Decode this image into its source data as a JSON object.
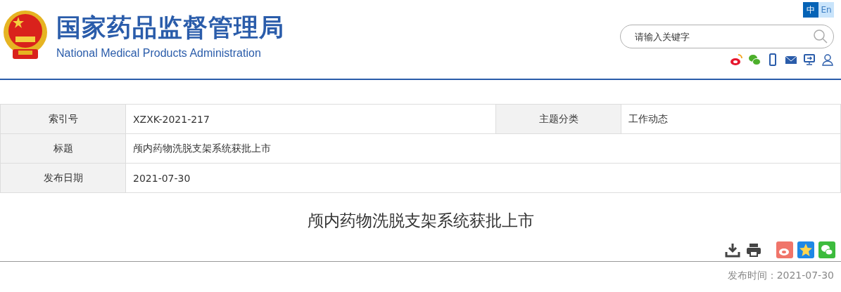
{
  "header": {
    "title": "国家药品监督管理局",
    "subtitle": "National Medical Products Administration",
    "languages": [
      {
        "label": "中",
        "selected": true
      },
      {
        "label": "En",
        "selected": false
      }
    ],
    "search": {
      "placeholder": "请输入关键字"
    }
  },
  "info_table": {
    "rows": [
      [
        {
          "label": "索引号",
          "value": "XZXK-2021-217"
        },
        {
          "label": "主题分类",
          "value": "工作动态"
        }
      ],
      [
        {
          "label": "标题",
          "value": "颅内药物洗脱支架系统获批上市"
        }
      ],
      [
        {
          "label": "发布日期",
          "value": "2021-07-30"
        }
      ]
    ]
  },
  "article": {
    "title": "颅内药物洗脱支架系统获批上市",
    "publish_time": "发布时间：2021-07-30"
  }
}
